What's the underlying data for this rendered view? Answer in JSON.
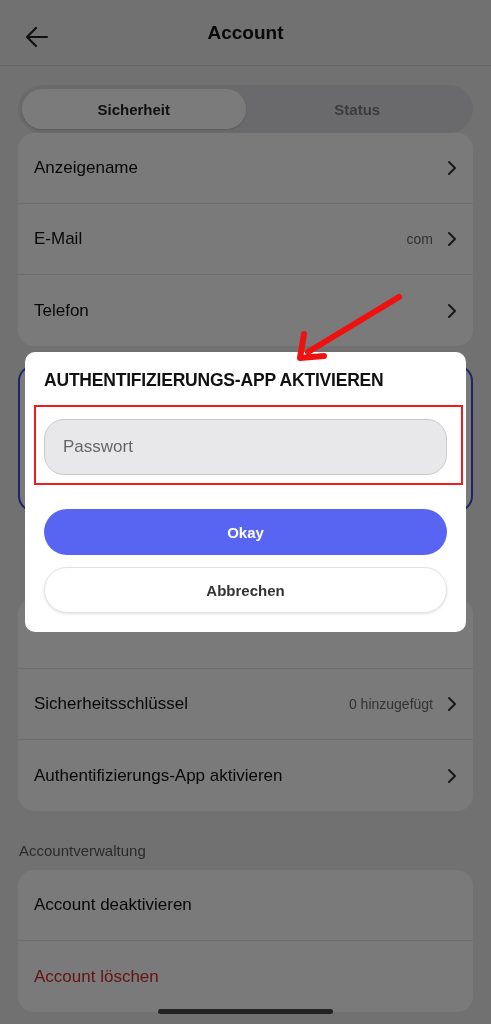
{
  "header": {
    "title": "Account"
  },
  "tabs": [
    {
      "label": "Sicherheit",
      "selected": true
    },
    {
      "label": "Status",
      "selected": false
    }
  ],
  "account_rows": [
    {
      "label": "Anzeigename"
    },
    {
      "label": "E-Mail",
      "value": "com"
    },
    {
      "label": "Telefon"
    }
  ],
  "security_section": {
    "rows": [
      {
        "kind": "covered"
      },
      {
        "label": "Sicherheitsschlüssel",
        "value": "0 hinzugefügt",
        "kind": "normal"
      },
      {
        "label": "Authentifizierungs-App aktivieren",
        "kind": "normal"
      }
    ]
  },
  "management_section": {
    "heading": "Accountverwaltung",
    "rows": [
      {
        "label": "Account deaktivieren",
        "kind": "normal"
      },
      {
        "label": "Account löschen",
        "kind": "danger"
      }
    ]
  },
  "dialog": {
    "title": "AUTHENTIFIZIERUNGS-APP AKTIVIEREN",
    "password_field": {
      "placeholder": "Passwort"
    },
    "buttons": [
      {
        "label": "Okay",
        "kind": "primary"
      },
      {
        "label": "Abbrechen",
        "kind": "secondary"
      }
    ]
  }
}
